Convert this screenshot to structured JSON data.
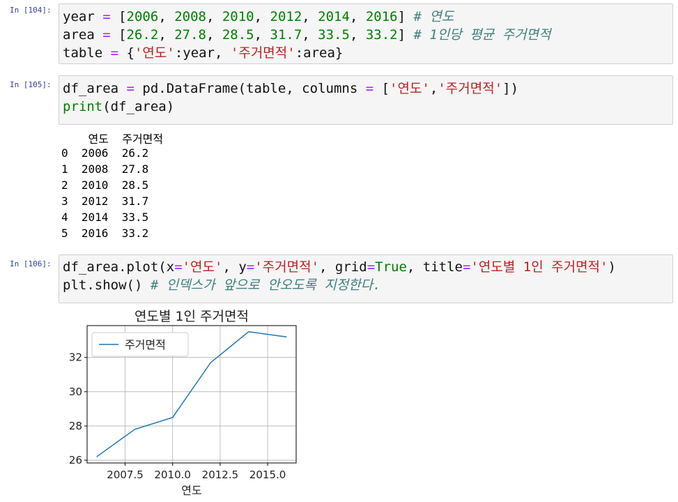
{
  "cells": [
    {
      "prompt": "In [104]:",
      "lines": [
        [
          [
            "t",
            "year "
          ],
          [
            "o",
            "= "
          ],
          [
            "t",
            "["
          ],
          [
            "n",
            "2006"
          ],
          [
            "t",
            ", "
          ],
          [
            "n",
            "2008"
          ],
          [
            "t",
            ", "
          ],
          [
            "n",
            "2010"
          ],
          [
            "t",
            ", "
          ],
          [
            "n",
            "2012"
          ],
          [
            "t",
            ", "
          ],
          [
            "n",
            "2014"
          ],
          [
            "t",
            ", "
          ],
          [
            "n",
            "2016"
          ],
          [
            "t",
            "] "
          ],
          [
            "c",
            "# 연도"
          ]
        ],
        [
          [
            "t",
            "area "
          ],
          [
            "o",
            "= "
          ],
          [
            "t",
            "["
          ],
          [
            "n",
            "26.2"
          ],
          [
            "t",
            ", "
          ],
          [
            "n",
            "27.8"
          ],
          [
            "t",
            ", "
          ],
          [
            "n",
            "28.5"
          ],
          [
            "t",
            ", "
          ],
          [
            "n",
            "31.7"
          ],
          [
            "t",
            ", "
          ],
          [
            "n",
            "33.5"
          ],
          [
            "t",
            ", "
          ],
          [
            "n",
            "33.2"
          ],
          [
            "t",
            "] "
          ],
          [
            "c",
            "# 1인당 평균 주거면적"
          ]
        ],
        [
          [
            "t",
            "table "
          ],
          [
            "o",
            "= "
          ],
          [
            "t",
            "{"
          ],
          [
            "s",
            "'연도'"
          ],
          [
            "t",
            ":year, "
          ],
          [
            "s",
            "'주거면적'"
          ],
          [
            "t",
            ":area}"
          ]
        ]
      ]
    },
    {
      "prompt": "In [105]:",
      "lines": [
        [
          [
            "t",
            "df_area "
          ],
          [
            "o",
            "= "
          ],
          [
            "t",
            "pd.DataFrame(table, columns "
          ],
          [
            "o",
            "= "
          ],
          [
            "t",
            "["
          ],
          [
            "s",
            "'연도'"
          ],
          [
            "t",
            ","
          ],
          [
            "s",
            "'주거면적'"
          ],
          [
            "t",
            "])"
          ]
        ],
        [
          [
            "k",
            "print"
          ],
          [
            "t",
            "(df_area)"
          ]
        ]
      ]
    },
    {
      "prompt": "In [106]:",
      "lines": [
        [
          [
            "t",
            "df_area.plot(x"
          ],
          [
            "o",
            "="
          ],
          [
            "s",
            "'연도'"
          ],
          [
            "t",
            ", y"
          ],
          [
            "o",
            "="
          ],
          [
            "s",
            "'주거면적'"
          ],
          [
            "t",
            ", grid"
          ],
          [
            "o",
            "="
          ],
          [
            "k",
            "True"
          ],
          [
            "t",
            ", title"
          ],
          [
            "o",
            "="
          ],
          [
            "s",
            "'연도별 1인 주거면적'"
          ],
          [
            "t",
            ")"
          ]
        ],
        [
          [
            "t",
            "plt.show() "
          ],
          [
            "c",
            "# 인덱스가 앞으로 안오도록 지정한다."
          ]
        ]
      ]
    }
  ],
  "dataframe_output": {
    "header": "    연도  주거면적",
    "rows": [
      "0  2006  26.2",
      "1  2008  27.8",
      "2  2010  28.5",
      "3  2012  31.7",
      "4  2014  33.5",
      "5  2016  33.2"
    ]
  },
  "colors": {
    "prompt": "#303f9f",
    "line": "#1f77b4",
    "comment": "#408080",
    "string": "#ba2121",
    "keyword": "#008000",
    "operator": "#aa22ff"
  },
  "chart_data": {
    "type": "line",
    "title": "연도별 1인 주거면적",
    "xlabel": "연도",
    "ylabel": "",
    "x": [
      2006,
      2008,
      2010,
      2012,
      2014,
      2016
    ],
    "series": [
      {
        "name": "주거면적",
        "values": [
          26.2,
          27.8,
          28.5,
          31.7,
          33.5,
          33.2
        ]
      }
    ],
    "xlim": [
      2005.5,
      2016.5
    ],
    "ylim": [
      25.84,
      33.86
    ],
    "xticks": [
      2007.5,
      2010.0,
      2012.5,
      2015.0
    ],
    "xtick_labels": [
      "2007.5",
      "2010.0",
      "2012.5",
      "2015.0"
    ],
    "yticks": [
      26,
      28,
      30,
      32
    ],
    "ytick_labels": [
      "26",
      "28",
      "30",
      "32"
    ],
    "grid": true,
    "legend": "upper-left"
  }
}
